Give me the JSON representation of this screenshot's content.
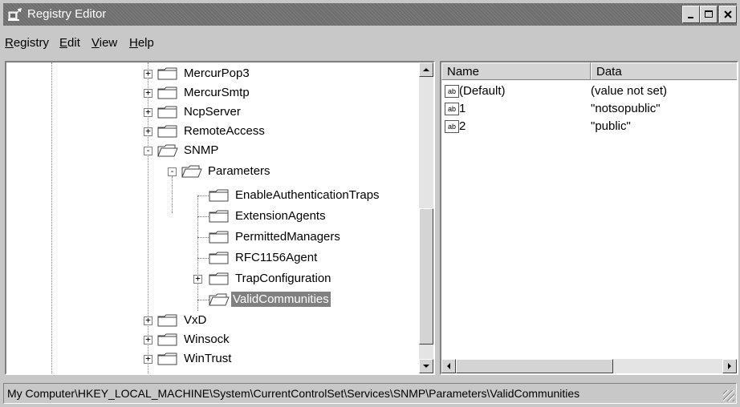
{
  "window": {
    "title": "Registry Editor"
  },
  "menu": [
    {
      "key": "R",
      "rest": "egistry"
    },
    {
      "key": "E",
      "rest": "dit"
    },
    {
      "key": "V",
      "rest": "iew"
    },
    {
      "key": "H",
      "rest": "elp"
    }
  ],
  "tree": {
    "nodes": [
      {
        "label": "MercurPop3",
        "expander": "+"
      },
      {
        "label": "MercurSmtp",
        "expander": "+"
      },
      {
        "label": "NcpServer",
        "expander": "+"
      },
      {
        "label": "RemoteAccess",
        "expander": "+"
      },
      {
        "label": "SNMP",
        "expander": "-"
      },
      {
        "label": "Parameters",
        "expander": "-"
      },
      {
        "label": "EnableAuthenticationTraps",
        "expander": ""
      },
      {
        "label": "ExtensionAgents",
        "expander": ""
      },
      {
        "label": "PermittedManagers",
        "expander": ""
      },
      {
        "label": "RFC1156Agent",
        "expander": ""
      },
      {
        "label": "TrapConfiguration",
        "expander": "+"
      },
      {
        "label": "ValidCommunities",
        "expander": "",
        "selected": true
      },
      {
        "label": "VxD",
        "expander": "+"
      },
      {
        "label": "Winsock",
        "expander": "+"
      },
      {
        "label": "WinTrust",
        "expander": "+"
      }
    ]
  },
  "values_pane": {
    "columns": {
      "name": "Name",
      "data": "Data"
    },
    "rows": [
      {
        "name": "(Default)",
        "data": "(value not set)"
      },
      {
        "name": "1",
        "data": "\"notsopublic\""
      },
      {
        "name": "2",
        "data": "\"public\""
      }
    ]
  },
  "status": {
    "path": "My Computer\\HKEY_LOCAL_MACHINE\\System\\CurrentControlSet\\Services\\SNMP\\Parameters\\ValidCommunities"
  },
  "icons": {
    "app": "registry-editor-icon",
    "folder": "folder-icon",
    "open_folder": "open-folder-icon",
    "string_value": "string-value-icon",
    "minimize": "minimize-icon",
    "maximize": "maximize-icon",
    "close": "close-icon"
  },
  "colors": {
    "selection": "#808080",
    "titlebar": "#6e6e6e",
    "face": "#c8c8c8"
  }
}
